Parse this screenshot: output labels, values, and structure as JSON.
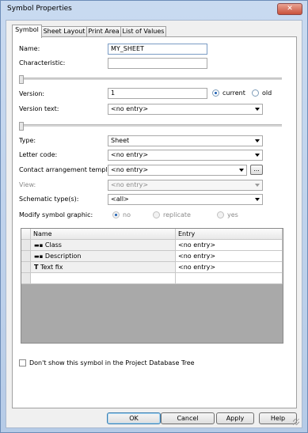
{
  "window": {
    "title": "Symbol Properties",
    "close_symbol": "✕"
  },
  "tabs": [
    {
      "label": "Symbol",
      "active": true
    },
    {
      "label": "Sheet Layout",
      "active": false
    },
    {
      "label": "Print Area",
      "active": false
    },
    {
      "label": "List of Values",
      "active": false
    }
  ],
  "form": {
    "name": {
      "label": "Name:",
      "value": "MY_SHEET"
    },
    "characteristic": {
      "label": "Characteristic:",
      "value": ""
    },
    "version": {
      "label": "Version:",
      "value": "1"
    },
    "version_mode": {
      "options": [
        "current",
        "old"
      ],
      "selected": "current"
    },
    "version_text": {
      "label": "Version text:",
      "value": "<no entry>"
    },
    "type": {
      "label": "Type:",
      "value": "Sheet"
    },
    "letter_code": {
      "label": "Letter code:",
      "value": "<no entry>"
    },
    "contact_template": {
      "label": "Contact arrangement template:",
      "value": "<no entry>",
      "browse_label": "..."
    },
    "view": {
      "label": "View:",
      "value": "<no entry>",
      "enabled": false
    },
    "schematic_types": {
      "label": "Schematic type(s):",
      "value": "<all>"
    },
    "modify_graphic": {
      "label": "Modify symbol graphic:",
      "options": [
        "no",
        "replicate",
        "yes"
      ],
      "selected": "no",
      "enabled": false
    }
  },
  "table": {
    "columns": [
      "Name",
      "Entry"
    ],
    "rows": [
      {
        "name": "Class",
        "entry": "<no entry>",
        "icon": "attribute-icon"
      },
      {
        "name": "Description",
        "entry": "<no entry>",
        "icon": "attribute-icon"
      },
      {
        "name": "Text fix",
        "entry": "<no entry>",
        "icon": "text-icon"
      },
      {
        "name": "",
        "entry": "",
        "icon": ""
      }
    ]
  },
  "checkbox": {
    "label": "Don't show this symbol in the Project Database Tree",
    "checked": false
  },
  "buttons": {
    "ok": "OK",
    "cancel": "Cancel",
    "apply": "Apply",
    "help": "Help"
  },
  "colors": {
    "title_bar": "#b6cbe7",
    "close_button": "#c9523b",
    "selected_radio": "#1b5fb4",
    "grid_background": "#a9a9a9"
  }
}
